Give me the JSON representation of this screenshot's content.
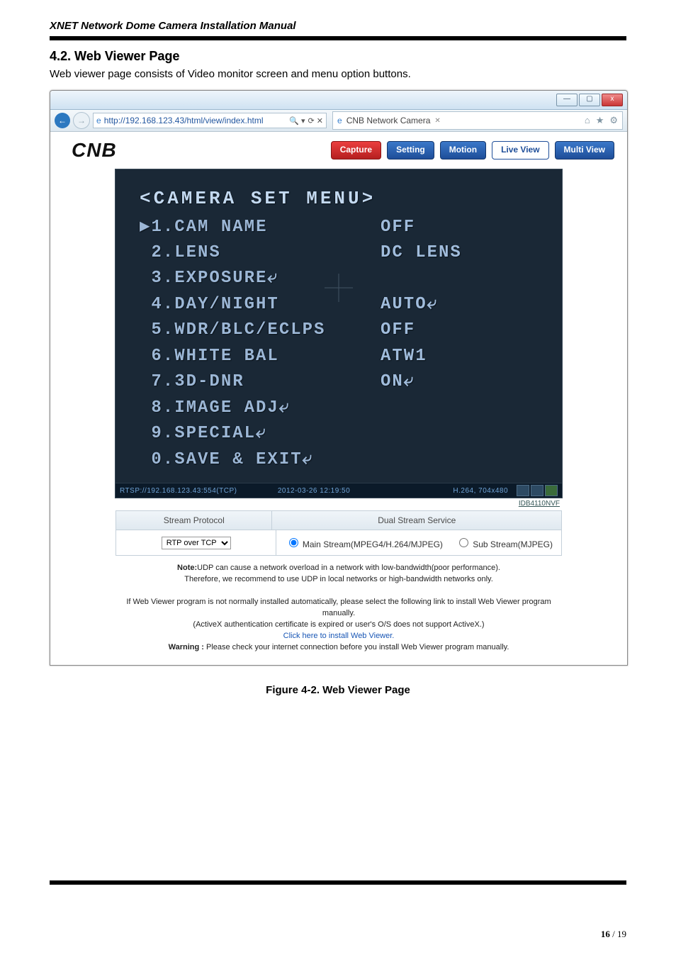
{
  "doc": {
    "header": "XNET Network Dome Camera Installation Manual",
    "section_title": "4.2. Web Viewer Page",
    "intro": "Web viewer page consists of Video monitor screen and menu option buttons.",
    "caption": "Figure 4-2. Web Viewer Page",
    "page_current": "16",
    "page_sep": " / ",
    "page_total": "19"
  },
  "window": {
    "controls": {
      "min": "—",
      "max": "▢",
      "close": "x"
    },
    "address_url": "http://192.168.123.43/html/view/index.html",
    "search_icons": "⟳ ✕",
    "search_glyph": "🔍 ▾",
    "tab_title": "CNB Network Camera",
    "tool_home": "⌂",
    "tool_star": "★",
    "tool_gear": "⚙"
  },
  "app": {
    "logo_text": "CNB",
    "toolbar": {
      "capture": "Capture",
      "setting": "Setting",
      "motion": "Motion",
      "live": "Live View",
      "multi": "Multi View"
    }
  },
  "osd": {
    "title": "<CAMERA SET  MENU>",
    "rows": [
      {
        "left": "▶1.CAM NAME",
        "right": "OFF"
      },
      {
        "left": " 2.LENS",
        "right": "DC LENS"
      },
      {
        "left": " 3.EXPOSURE⤶",
        "right": ""
      },
      {
        "left": " 4.DAY/NIGHT",
        "right": "AUTO⤶"
      },
      {
        "left": " 5.WDR/BLC/ECLPS",
        "right": "OFF"
      },
      {
        "left": " 6.WHITE BAL",
        "right": "ATW1"
      },
      {
        "left": " 7.3D-DNR",
        "right": "ON⤶"
      },
      {
        "left": " 8.IMAGE ADJ⤶",
        "right": ""
      },
      {
        "left": " 9.SPECIAL⤶",
        "right": ""
      },
      {
        "left": " 0.SAVE & EXIT⤶",
        "right": ""
      }
    ]
  },
  "video_status": {
    "stream_url": "RTSP://192.168.123.43:554(TCP)",
    "timestamp": "2012-03-26 12:19:50",
    "codec": "H.264, 704x480",
    "model": "IDB4110NVF"
  },
  "panel": {
    "head_stream": "Stream Protocol",
    "head_dual": "Dual Stream Service",
    "select_value": "RTP over TCP",
    "main_stream": "Main Stream(MPEG4/H.264/MJPEG)",
    "sub_stream": "Sub Stream(MJPEG)"
  },
  "notes": {
    "note_bold": "Note:",
    "note_rest": "UDP can cause a network overload in a network with low-bandwidth(poor performance).",
    "note_line2": "Therefore, we recommend to use UDP in local networks or high-bandwidth networks only.",
    "inst1": "If Web Viewer program is not normally installed automatically, please select the following link to install Web Viewer program manually.",
    "inst2": "(ActiveX authentication certificate is expired or user's O/S does not support ActiveX.)",
    "link": "Click here to install Web Viewer.",
    "warn_bold": "Warning :",
    "warn_rest": " Please check your internet connection before you install Web Viewer program manually."
  }
}
